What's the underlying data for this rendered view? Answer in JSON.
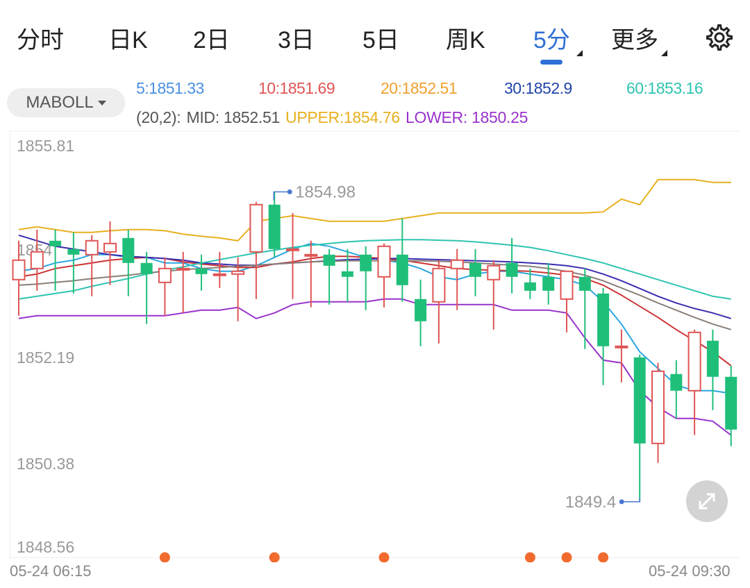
{
  "tabs": {
    "items": [
      {
        "label": "分时",
        "active": false
      },
      {
        "label": "日K",
        "active": false
      },
      {
        "label": "2日",
        "active": false
      },
      {
        "label": "3日",
        "active": false
      },
      {
        "label": "5日",
        "active": false
      },
      {
        "label": "周K",
        "active": false
      },
      {
        "label": "5分",
        "active": true
      },
      {
        "label": "更多",
        "active": false
      }
    ],
    "settings_icon": "gear-icon"
  },
  "indicator": {
    "label": "MABOLL",
    "ma": [
      {
        "text": "5:1851.33",
        "color": "#4a90e2"
      },
      {
        "text": "10:1851.69",
        "color": "#e05555"
      },
      {
        "text": "20:1852.51",
        "color": "#f0a030"
      },
      {
        "text": "30:1852.9",
        "color": "#2244aa"
      },
      {
        "text": "60:1853.16",
        "color": "#2ec4b0"
      }
    ],
    "boll": {
      "params": "(20,2):",
      "mid": "MID: 1852.51",
      "upper": "UPPER:1854.76",
      "lower": "LOWER: 1850.25",
      "params_color": "#555555",
      "mid_color": "#555555",
      "upper_color": "#e8b020",
      "lower_color": "#9933cc"
    }
  },
  "colors": {
    "up": "#e05555",
    "down": "#1fbf7a",
    "axis_text": "#999999",
    "dot": "#f26b2e"
  },
  "chart_data": {
    "type": "candlestick",
    "ylim": [
      1848.56,
      1855.81
    ],
    "y_ticks": [
      "1855.81",
      "1854",
      "1852.19",
      "1850.38",
      "1848.56"
    ],
    "x_labels": [
      "05-24 06:15",
      "05-24 09:30"
    ],
    "annotations": [
      {
        "label": "1854.98",
        "value": 1854.98,
        "candle_index": 14
      },
      {
        "label": "1849.4",
        "value": 1849.4,
        "candle_index": 34
      }
    ],
    "event_dot_candle_indices": [
      8,
      14,
      20,
      28,
      30,
      32
    ],
    "candles": [
      {
        "o": 1853.4,
        "h": 1854.1,
        "l": 1852.75,
        "c": 1853.75
      },
      {
        "o": 1853.6,
        "h": 1854.3,
        "l": 1853.2,
        "c": 1853.9
      },
      {
        "o": 1854.1,
        "h": 1854.3,
        "l": 1853.2,
        "c": 1854.0
      },
      {
        "o": 1853.95,
        "h": 1854.25,
        "l": 1853.15,
        "c": 1853.85
      },
      {
        "o": 1853.85,
        "h": 1854.2,
        "l": 1853.1,
        "c": 1854.1
      },
      {
        "o": 1853.9,
        "h": 1854.45,
        "l": 1853.3,
        "c": 1854.05
      },
      {
        "o": 1854.15,
        "h": 1854.3,
        "l": 1853.1,
        "c": 1853.7
      },
      {
        "o": 1853.7,
        "h": 1853.9,
        "l": 1852.6,
        "c": 1853.5
      },
      {
        "o": 1853.35,
        "h": 1853.8,
        "l": 1852.75,
        "c": 1853.6
      },
      {
        "o": 1853.6,
        "h": 1853.9,
        "l": 1852.8,
        "c": 1853.6
      },
      {
        "o": 1853.6,
        "h": 1853.85,
        "l": 1853.2,
        "c": 1853.5
      },
      {
        "o": 1853.5,
        "h": 1853.9,
        "l": 1853.25,
        "c": 1853.5
      },
      {
        "o": 1853.5,
        "h": 1853.8,
        "l": 1852.65,
        "c": 1853.55
      },
      {
        "o": 1853.9,
        "h": 1854.8,
        "l": 1853.05,
        "c": 1854.75
      },
      {
        "o": 1854.75,
        "h": 1854.98,
        "l": 1853.8,
        "c": 1853.95
      },
      {
        "o": 1853.95,
        "h": 1854.6,
        "l": 1853.05,
        "c": 1853.95
      },
      {
        "o": 1853.85,
        "h": 1854.1,
        "l": 1852.9,
        "c": 1853.85
      },
      {
        "o": 1853.85,
        "h": 1853.95,
        "l": 1852.95,
        "c": 1853.65
      },
      {
        "o": 1853.55,
        "h": 1853.95,
        "l": 1853.0,
        "c": 1853.45
      },
      {
        "o": 1853.85,
        "h": 1854.0,
        "l": 1852.85,
        "c": 1853.55
      },
      {
        "o": 1853.45,
        "h": 1854.05,
        "l": 1852.9,
        "c": 1854.0
      },
      {
        "o": 1853.85,
        "h": 1854.5,
        "l": 1853.0,
        "c": 1853.3
      },
      {
        "o": 1853.05,
        "h": 1853.4,
        "l": 1852.2,
        "c": 1852.65
      },
      {
        "o": 1853.0,
        "h": 1853.75,
        "l": 1852.25,
        "c": 1853.6
      },
      {
        "o": 1853.6,
        "h": 1853.95,
        "l": 1852.85,
        "c": 1853.75
      },
      {
        "o": 1853.7,
        "h": 1853.95,
        "l": 1853.1,
        "c": 1853.45
      },
      {
        "o": 1853.4,
        "h": 1853.75,
        "l": 1852.5,
        "c": 1853.65
      },
      {
        "o": 1853.7,
        "h": 1854.15,
        "l": 1853.15,
        "c": 1853.45
      },
      {
        "o": 1853.35,
        "h": 1853.6,
        "l": 1853.05,
        "c": 1853.2
      },
      {
        "o": 1853.45,
        "h": 1853.7,
        "l": 1852.95,
        "c": 1853.2
      },
      {
        "o": 1853.05,
        "h": 1853.55,
        "l": 1852.45,
        "c": 1853.55
      },
      {
        "o": 1853.45,
        "h": 1853.6,
        "l": 1852.15,
        "c": 1853.2
      },
      {
        "o": 1853.15,
        "h": 1853.25,
        "l": 1851.5,
        "c": 1852.2
      },
      {
        "o": 1852.2,
        "h": 1852.5,
        "l": 1851.55,
        "c": 1852.2
      },
      {
        "o": 1852.0,
        "h": 1852.05,
        "l": 1849.4,
        "c": 1850.45
      },
      {
        "o": 1850.45,
        "h": 1851.9,
        "l": 1850.1,
        "c": 1851.75
      },
      {
        "o": 1851.7,
        "h": 1851.95,
        "l": 1850.9,
        "c": 1851.4
      },
      {
        "o": 1851.4,
        "h": 1852.5,
        "l": 1850.6,
        "c": 1852.45
      },
      {
        "o": 1852.3,
        "h": 1852.5,
        "l": 1851.05,
        "c": 1851.65
      },
      {
        "o": 1851.65,
        "h": 1851.85,
        "l": 1850.4,
        "c": 1850.7
      }
    ],
    "lines": [
      {
        "name": "5",
        "color": "#2aa6e0",
        "values": [
          1853.55,
          1853.6,
          1853.7,
          1853.75,
          1853.85,
          1853.85,
          1853.8,
          1853.8,
          1853.7,
          1853.7,
          1853.6,
          1853.55,
          1853.55,
          1853.65,
          1853.8,
          1853.95,
          1854.05,
          1854.0,
          1853.9,
          1853.8,
          1853.75,
          1853.7,
          1853.6,
          1853.45,
          1853.4,
          1853.5,
          1853.55,
          1853.55,
          1853.5,
          1853.45,
          1853.4,
          1853.3,
          1853.0,
          1852.6,
          1852.1,
          1851.8,
          1851.5,
          1851.4,
          1851.4,
          1851.35
        ]
      },
      {
        "name": "10",
        "color": "#cc3333",
        "values": [
          1853.45,
          1853.5,
          1853.6,
          1853.65,
          1853.7,
          1853.75,
          1853.78,
          1853.8,
          1853.78,
          1853.72,
          1853.68,
          1853.65,
          1853.62,
          1853.62,
          1853.68,
          1853.72,
          1853.78,
          1853.82,
          1853.82,
          1853.8,
          1853.78,
          1853.75,
          1853.7,
          1853.65,
          1853.6,
          1853.58,
          1853.57,
          1853.56,
          1853.55,
          1853.52,
          1853.48,
          1853.42,
          1853.3,
          1853.12,
          1852.92,
          1852.72,
          1852.5,
          1852.3,
          1852.1,
          1851.85
        ]
      },
      {
        "name": "20",
        "color": "#e8b020",
        "values": [
          1854.3,
          1854.35,
          1854.3,
          1854.25,
          1854.25,
          1854.28,
          1854.3,
          1854.3,
          1854.28,
          1854.22,
          1854.18,
          1854.15,
          1854.1,
          1854.45,
          1854.5,
          1854.55,
          1854.5,
          1854.45,
          1854.45,
          1854.45,
          1854.45,
          1854.5,
          1854.55,
          1854.6,
          1854.6,
          1854.6,
          1854.6,
          1854.6,
          1854.6,
          1854.6,
          1854.6,
          1854.6,
          1854.62,
          1854.85,
          1854.75,
          1855.2,
          1855.2,
          1855.2,
          1855.15,
          1855.15
        ]
      },
      {
        "name": "30",
        "color": "#3a2db0",
        "values": [
          1854.2,
          1854.1,
          1854.0,
          1853.95,
          1853.9,
          1853.85,
          1853.82,
          1853.8,
          1853.78,
          1853.75,
          1853.7,
          1853.68,
          1853.66,
          1853.66,
          1853.68,
          1853.7,
          1853.72,
          1853.74,
          1853.76,
          1853.77,
          1853.78,
          1853.78,
          1853.77,
          1853.76,
          1853.75,
          1853.74,
          1853.73,
          1853.72,
          1853.7,
          1853.68,
          1853.65,
          1853.6,
          1853.5,
          1853.38,
          1853.24,
          1853.1,
          1852.98,
          1852.88,
          1852.8,
          1852.7
        ]
      },
      {
        "name": "60",
        "color": "#2ec4b0",
        "values": [
          1853.05,
          1853.1,
          1853.15,
          1853.2,
          1853.28,
          1853.35,
          1853.42,
          1853.5,
          1853.57,
          1853.63,
          1853.7,
          1853.76,
          1853.82,
          1853.88,
          1853.93,
          1853.98,
          1854.02,
          1854.05,
          1854.08,
          1854.1,
          1854.11,
          1854.12,
          1854.12,
          1854.11,
          1854.1,
          1854.08,
          1854.05,
          1854.02,
          1853.98,
          1853.92,
          1853.85,
          1853.78,
          1853.7,
          1853.6,
          1853.5,
          1853.4,
          1853.3,
          1853.2,
          1853.1,
          1853.05
        ]
      },
      {
        "name": "MID",
        "color": "#8a7f78",
        "values": [
          1853.3,
          1853.32,
          1853.35,
          1853.38,
          1853.42,
          1853.45,
          1853.48,
          1853.52,
          1853.55,
          1853.58,
          1853.6,
          1853.62,
          1853.64,
          1853.66,
          1853.68,
          1853.7,
          1853.72,
          1853.73,
          1853.74,
          1853.74,
          1853.74,
          1853.74,
          1853.74,
          1853.73,
          1853.72,
          1853.7,
          1853.68,
          1853.66,
          1853.64,
          1853.6,
          1853.55,
          1853.48,
          1853.38,
          1853.25,
          1853.12,
          1852.98,
          1852.85,
          1852.72,
          1852.6,
          1852.5
        ]
      },
      {
        "name": "LOWER",
        "color": "#9933cc",
        "values": [
          1852.7,
          1852.75,
          1852.75,
          1852.75,
          1852.75,
          1852.75,
          1852.75,
          1852.75,
          1852.75,
          1852.8,
          1852.85,
          1852.85,
          1852.9,
          1852.7,
          1852.8,
          1852.95,
          1853.0,
          1853.0,
          1853.0,
          1853.0,
          1853.05,
          1853.05,
          1852.95,
          1852.95,
          1852.95,
          1852.95,
          1852.95,
          1852.85,
          1852.85,
          1852.85,
          1852.8,
          1852.35,
          1851.95,
          1851.9,
          1851.4,
          1851.1,
          1850.9,
          1850.9,
          1850.85,
          1850.6
        ]
      }
    ]
  }
}
